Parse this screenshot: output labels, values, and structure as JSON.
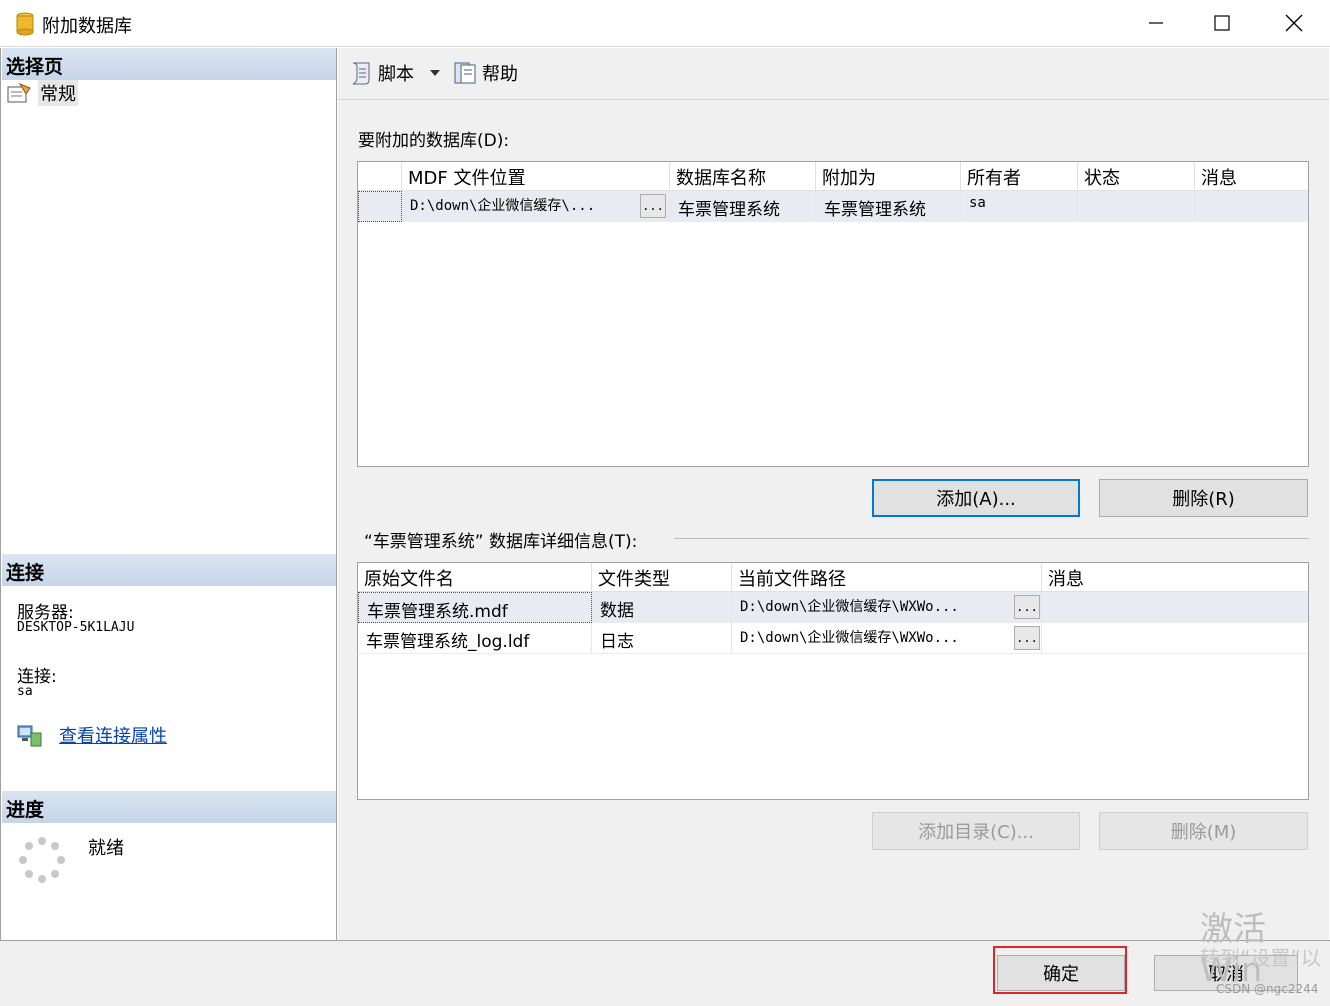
{
  "window": {
    "title": "附加数据库",
    "controls": {
      "minimize": "minimize-icon",
      "maximize": "maximize-icon",
      "close": "close-icon"
    }
  },
  "sidebar": {
    "select_page_header": "选择页",
    "items": [
      {
        "label": "常规",
        "icon": "general-page-icon"
      }
    ],
    "connection_header": "连接",
    "server_label": "服务器:",
    "server_value": "DESKTOP-5K1LAJU",
    "connection_label": "连接:",
    "connection_value": "sa",
    "view_properties_link": "查看连接属性",
    "progress_header": "进度",
    "progress_status": "就绪"
  },
  "toolbar": {
    "script_label": "脚本",
    "help_label": "帮助"
  },
  "attach": {
    "label": "要附加的数据库(D):",
    "columns": [
      "MDF 文件位置",
      "数据库名称",
      "附加为",
      "所有者",
      "状态",
      "消息"
    ],
    "rows": [
      {
        "mdf": "D:\\down\\企业微信缓存\\...",
        "db_name": "车票管理系统",
        "attach_as": "车票管理系统",
        "owner": "sa",
        "status": "",
        "message": ""
      }
    ],
    "add_button": "添加(A)...",
    "remove_button": "删除(R)"
  },
  "details": {
    "label": "“车票管理系统” 数据库详细信息(T):",
    "columns": [
      "原始文件名",
      "文件类型",
      "当前文件路径",
      "消息"
    ],
    "rows": [
      {
        "name": "车票管理系统.mdf",
        "type": "数据",
        "path": "D:\\down\\企业微信缓存\\WXWo...",
        "message": ""
      },
      {
        "name": "车票管理系统_log.ldf",
        "type": "日志",
        "path": "D:\\down\\企业微信缓存\\WXWo...",
        "message": ""
      }
    ],
    "add_catalog_button": "添加目录(C)...",
    "remove_button": "删除(M)"
  },
  "footer": {
    "ok_button": "确定",
    "cancel_button": "取消"
  },
  "overlay": {
    "activate_line1": "激活 Win",
    "activate_line2": "转到“设置”以",
    "csdn": "CSDN @ngc2244"
  },
  "dots_label": "..."
}
